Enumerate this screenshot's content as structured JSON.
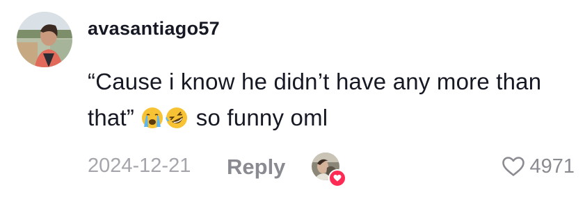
{
  "comment": {
    "username": "avasantiago57",
    "text_before_emoji": "“Cause i know he didn’t have any more than that”",
    "emojis": [
      "loudly-crying-face-emoji",
      "rolling-on-floor-laughing-emoji"
    ],
    "text_after_emoji": "so funny oml",
    "date": "2024-12-21",
    "reply_label": "Reply",
    "like_count": "4971",
    "creator_liked": true
  },
  "icons": {
    "like": "heart-outline-icon",
    "creator_badge": "heart-filled-icon"
  },
  "colors": {
    "text_primary": "#161823",
    "text_muted": "#a5a6ab",
    "text_secondary": "#8a8b91",
    "badge_red": "#fe2c55"
  }
}
